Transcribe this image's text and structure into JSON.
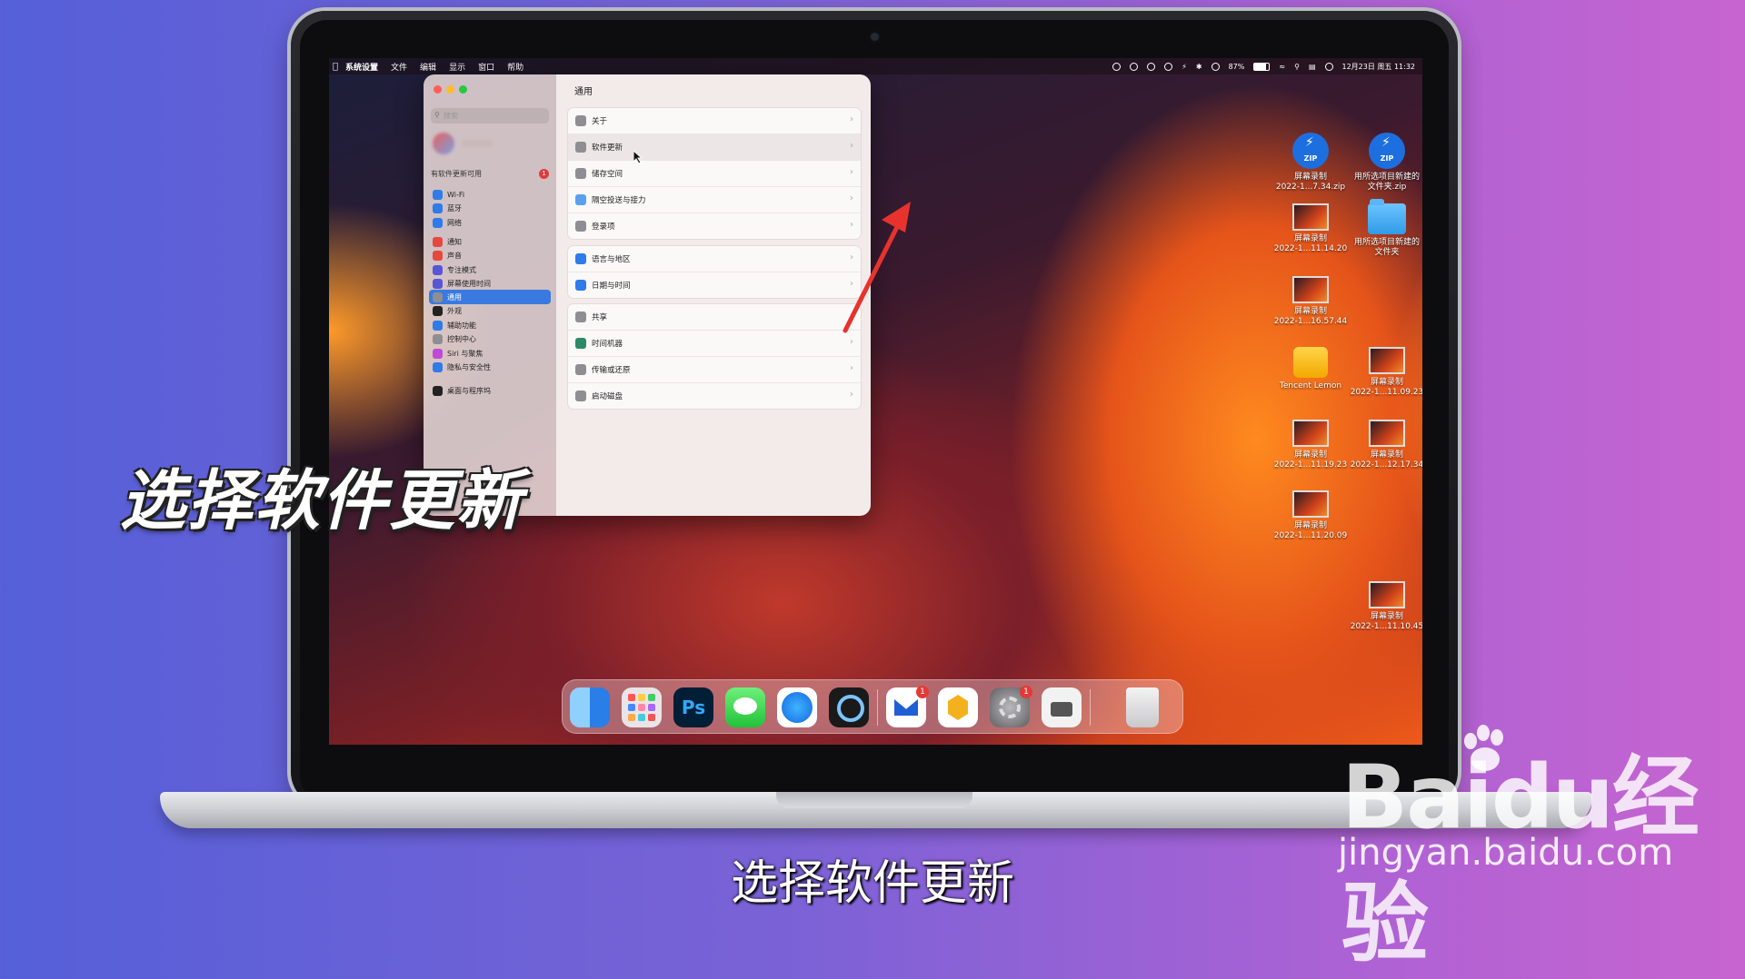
{
  "menubar": {
    "app": "系统设置",
    "items": [
      "文件",
      "编辑",
      "显示",
      "窗口",
      "帮助"
    ],
    "battery": "87%",
    "datetime": "12月23日 周五 11:32"
  },
  "sidebar": {
    "search_placeholder": "搜索",
    "update_notice": "有软件更新可用",
    "update_badge": "1",
    "groups": [
      [
        {
          "label": "Wi-Fi",
          "color": "#2f7bea"
        },
        {
          "label": "蓝牙",
          "color": "#2f7bea"
        },
        {
          "label": "网络",
          "color": "#2f7bea"
        }
      ],
      [
        {
          "label": "通知",
          "color": "#e5483f"
        },
        {
          "label": "声音",
          "color": "#e5483f"
        },
        {
          "label": "专注模式",
          "color": "#5856d6"
        },
        {
          "label": "屏幕使用时间",
          "color": "#5856d6"
        }
      ],
      [
        {
          "label": "通用",
          "color": "#8e8e93",
          "selected": true
        },
        {
          "label": "外观",
          "color": "#222222"
        },
        {
          "label": "辅助功能",
          "color": "#2f7bea"
        },
        {
          "label": "控制中心",
          "color": "#8e8e93"
        },
        {
          "label": "Siri 与聚焦",
          "color": "#c04ad8"
        },
        {
          "label": "隐私与安全性",
          "color": "#2f7bea"
        }
      ],
      [
        {
          "label": "桌面与程序坞",
          "color": "#222222"
        }
      ]
    ]
  },
  "main": {
    "title": "通用",
    "groups": [
      [
        "关于",
        "软件更新",
        "储存空间",
        "隔空投送与接力",
        "登录项"
      ],
      [
        "语言与地区",
        "日期与时间"
      ],
      [
        "共享",
        "时间机器",
        "传输或还原",
        "启动磁盘"
      ]
    ]
  },
  "desktop": [
    {
      "label": "屏幕录制\n2022-1...7.34.zip",
      "kind": "zip"
    },
    {
      "label": "用所选项目新建的\n文件夹.zip",
      "kind": "zip"
    },
    {
      "label": "屏幕录制\n2022-1...11.14.20",
      "kind": "video"
    },
    {
      "label": "用所选项目新建的\n文件夹",
      "kind": "folder"
    },
    {
      "label": "屏幕录制\n2022-1...16.57.44",
      "kind": "video"
    },
    {
      "label": "Tencent Lemon",
      "kind": "lemon"
    },
    {
      "label": "屏幕录制\n2022-1...11.09.23",
      "kind": "video"
    },
    {
      "label": "屏幕录制\n2022-1...11.19.23",
      "kind": "video"
    },
    {
      "label": "屏幕录制\n2022-1...12.17.34",
      "kind": "video"
    },
    {
      "label": "屏幕录制\n2022-1...11.20.09",
      "kind": "video"
    },
    {
      "label": "屏幕录制\n2022-1...11.10.45",
      "kind": "video"
    }
  ],
  "dock": {
    "apps": [
      "finder-icon",
      "launchpad-icon",
      "photoshop-icon",
      "messages-icon",
      "safari-icon",
      "quicktime-icon",
      "mail-icon",
      "lemon-icon",
      "settings-icon",
      "screenshot-icon",
      "trash-icon"
    ],
    "photoshop_label": "Ps",
    "badges": {
      "mail": "1",
      "settings": "1"
    }
  },
  "overlay": {
    "big_caption": "选择软件更新",
    "subtitle": "选择软件更新"
  },
  "watermark": {
    "logo": "Baidu经验",
    "url": "jingyan.baidu.com"
  }
}
